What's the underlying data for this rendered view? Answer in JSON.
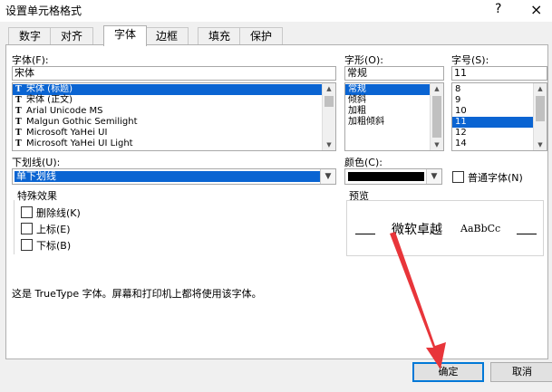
{
  "window": {
    "title": "设置单元格格式",
    "help": "?",
    "close": "×"
  },
  "tabs": [
    "数字",
    "对齐",
    "字体",
    "边框",
    "填充",
    "保护"
  ],
  "active_tab": 2,
  "font": {
    "label": "字体(F):",
    "value": "宋体",
    "items": [
      {
        "name": "宋体 (标题)",
        "selected": true
      },
      {
        "name": "宋体 (正文)",
        "selected": false
      },
      {
        "name": "Arial Unicode MS",
        "selected": false
      },
      {
        "name": "Malgun Gothic Semilight",
        "selected": false
      },
      {
        "name": "Microsoft YaHei UI",
        "selected": false
      },
      {
        "name": "Microsoft YaHei UI Light",
        "selected": false
      }
    ],
    "font_icon": "T"
  },
  "style": {
    "label": "字形(O):",
    "value": "常规",
    "items": [
      {
        "name": "常规",
        "selected": true
      },
      {
        "name": "倾斜",
        "selected": false
      },
      {
        "name": "加粗",
        "selected": false
      },
      {
        "name": "加粗倾斜",
        "selected": false
      }
    ]
  },
  "size": {
    "label": "字号(S):",
    "value": "11",
    "items": [
      {
        "name": "8",
        "selected": false
      },
      {
        "name": "9",
        "selected": false
      },
      {
        "name": "10",
        "selected": false
      },
      {
        "name": "11",
        "selected": true
      },
      {
        "name": "12",
        "selected": false
      },
      {
        "name": "14",
        "selected": false
      }
    ]
  },
  "underline": {
    "label": "下划线(U):",
    "value": "单下划线"
  },
  "color": {
    "label": "颜色(C):",
    "swatch": "#000000"
  },
  "normal_font": {
    "label": "普通字体(N)",
    "checked": false
  },
  "effects": {
    "label": "特殊效果",
    "items": [
      {
        "label": "删除线(K)",
        "checked": false
      },
      {
        "label": "上标(E)",
        "checked": false
      },
      {
        "label": "下标(B)",
        "checked": false
      }
    ]
  },
  "preview": {
    "label": "预览",
    "sample_cn": "微软卓越",
    "sample_en": "AaBbCc"
  },
  "description": "这是 TrueType 字体。屏幕和打印机上都将使用该字体。",
  "buttons": {
    "ok": "确定",
    "cancel": "取消"
  },
  "accent_color": "#0a64d2",
  "annotation_color": "#e8353a"
}
